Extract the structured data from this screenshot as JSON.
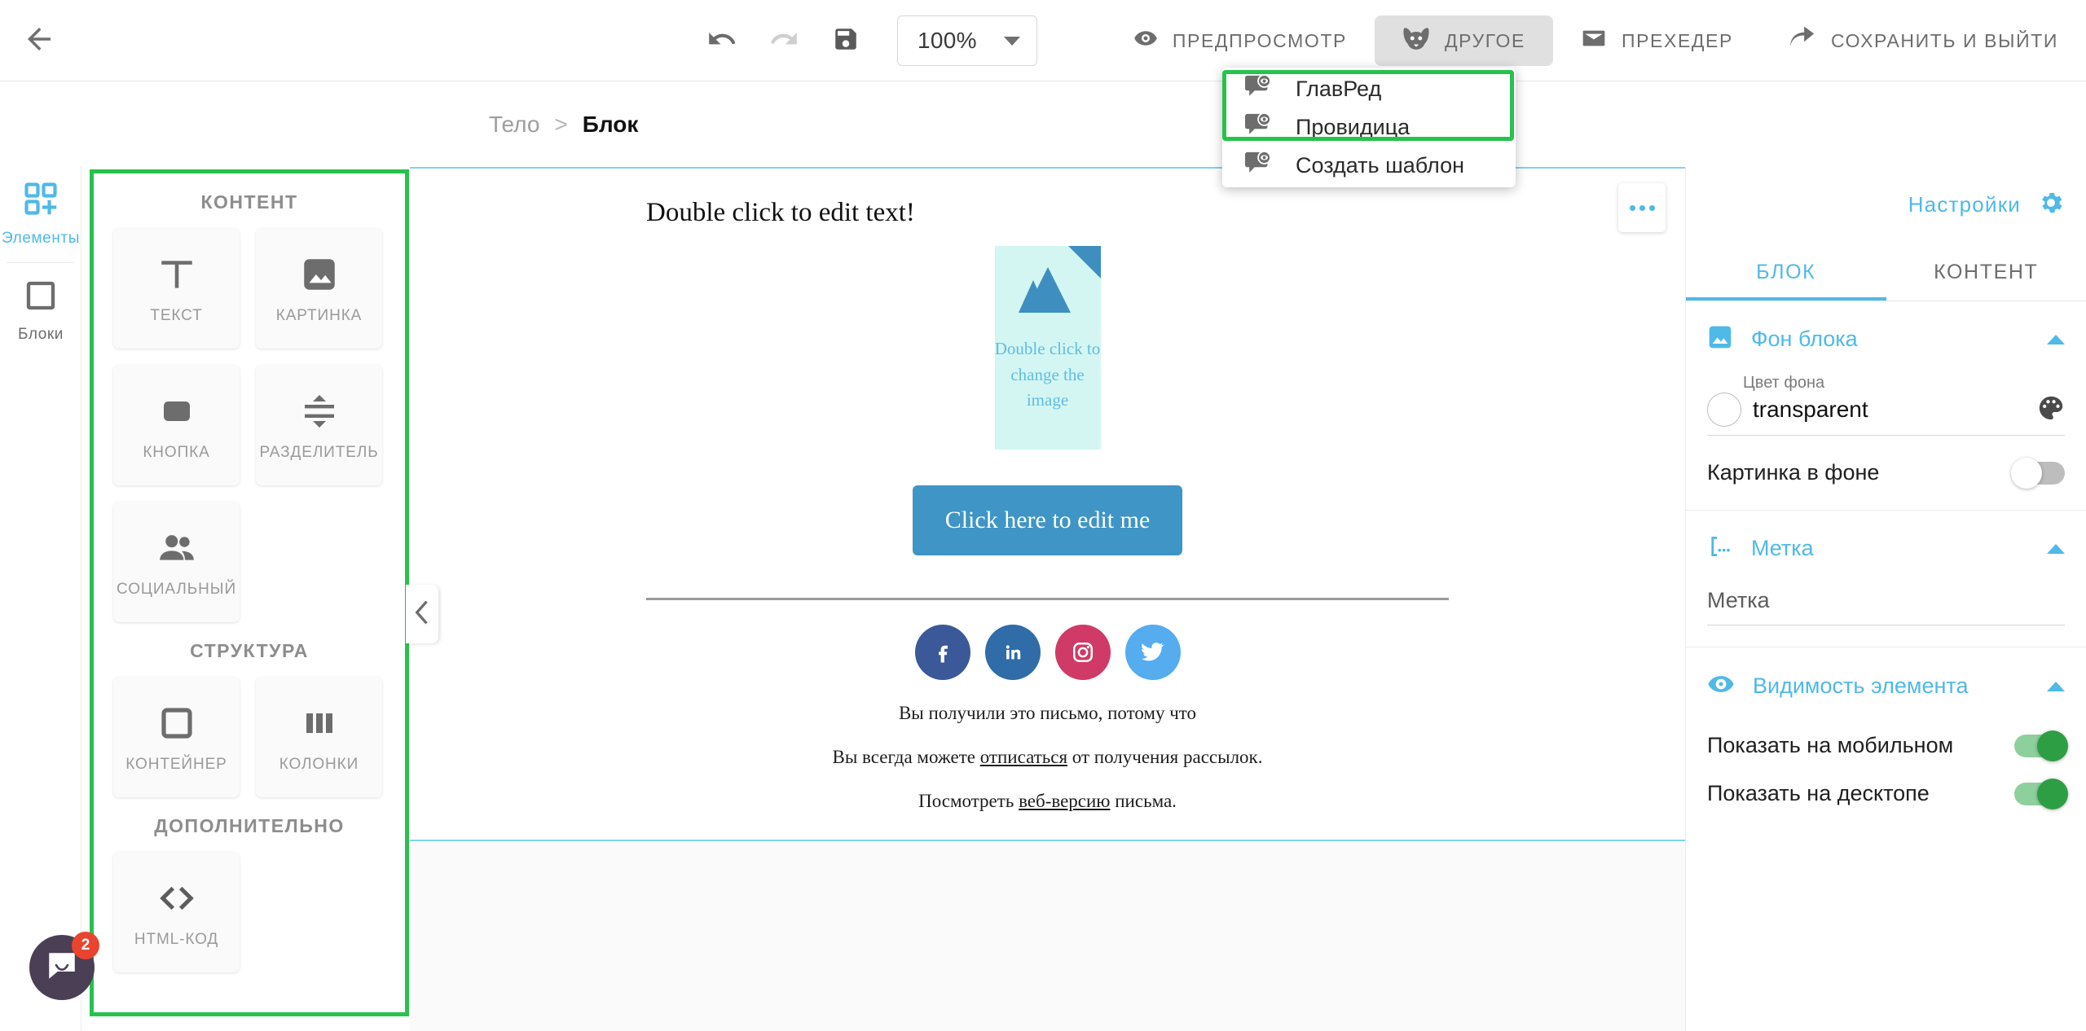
{
  "toolbar": {
    "back_icon": "arrow-left-icon",
    "undo_icon": "undo-icon",
    "redo_icon": "redo-icon",
    "save_icon": "floppy-save-icon",
    "zoom_value": "100%",
    "actions": [
      {
        "id": "preview",
        "label": "ПРЕДПРОСМОТР",
        "icon": "eye-icon",
        "active": false
      },
      {
        "id": "other",
        "label": "ДРУГОЕ",
        "icon": "dog-face-icon",
        "active": true
      },
      {
        "id": "preheader",
        "label": "ПРЕХЕДЕР",
        "icon": "envelope-icon",
        "active": false
      },
      {
        "id": "save-exit",
        "label": "СОХРАНИТЬ И ВЫЙТИ",
        "icon": "share-arrow-icon",
        "active": false
      }
    ]
  },
  "dropdown": {
    "items": [
      {
        "label": "ГлавРед",
        "icon": "speech-eye-icon",
        "highlighted": true
      },
      {
        "label": "Провидица",
        "icon": "speech-eye-icon",
        "highlighted": true
      },
      {
        "label": "Создать шаблон",
        "icon": "speech-eye-icon",
        "highlighted": false
      }
    ]
  },
  "breadcrumb": {
    "icon": "tree-structure-icon",
    "root": "Тело",
    "separator": ">",
    "current": "Блок"
  },
  "rail": {
    "items": [
      {
        "id": "elements",
        "label": "Элементы",
        "icon": "grid-plus-icon",
        "selected": true
      },
      {
        "id": "blocks",
        "label": "Блоки",
        "icon": "square-outline-icon",
        "selected": false
      }
    ]
  },
  "elements_panel": {
    "sections": [
      {
        "title": "КОНТЕНТ",
        "cards": [
          {
            "label": "ТЕКСТ",
            "icon": "text-t-icon"
          },
          {
            "label": "КАРТИНКА",
            "icon": "image-icon"
          },
          {
            "label": "КНОПКА",
            "icon": "button-rect-icon"
          },
          {
            "label": "РАЗДЕЛИТЕЛЬ",
            "icon": "divider-arrows-icon"
          },
          {
            "label": "СОЦИАЛЬНЫЙ",
            "icon": "people-icon"
          }
        ]
      },
      {
        "title": "СТРУКТУРА",
        "cards": [
          {
            "label": "КОНТЕЙНЕР",
            "icon": "container-square-icon"
          },
          {
            "label": "КОЛОНКИ",
            "icon": "columns-icon"
          }
        ]
      },
      {
        "title": "ДОПОЛНИТЕЛЬНО",
        "cards": [
          {
            "label": "HTML-КОД",
            "icon": "code-brackets-icon"
          }
        ]
      }
    ]
  },
  "canvas": {
    "heading": "Double click to edit text!",
    "image_caption_line1": "Double click to",
    "image_caption_line2": "change the image",
    "cta_label": "Click here to edit me",
    "socials": [
      {
        "name": "facebook-icon",
        "color": "#3b5998"
      },
      {
        "name": "linkedin-icon",
        "color": "#2f6ca8"
      },
      {
        "name": "instagram-icon",
        "color": "#cf3a67"
      },
      {
        "name": "twitter-icon",
        "color": "#55acee"
      }
    ],
    "footer_line1": "Вы получили это письмо, потому что",
    "footer_line2_pre": "Вы всегда можете ",
    "footer_line2_link": "отписаться",
    "footer_line2_post": " от получения рассылок.",
    "footer_line3_pre": "Посмотреть ",
    "footer_line3_link": "веб-версию",
    "footer_line3_post": " письма.",
    "options_icon": "more-options-dots-icon",
    "collapse_icon": "chevron-left-icon"
  },
  "right_panel": {
    "settings_label": "Настройки",
    "settings_icon": "gear-icon",
    "tabs": [
      {
        "label": "БЛОК",
        "active": true
      },
      {
        "label": "КОНТЕНТ",
        "active": false
      }
    ],
    "sections": [
      {
        "id": "background",
        "title": "Фон блока",
        "icon": "image-icon",
        "expanded": true,
        "color_label": "Цвет фона",
        "color_value": "transparent",
        "palette_icon": "palette-icon",
        "bg_image_label": "Картинка в фоне",
        "bg_image_on": false
      },
      {
        "id": "label",
        "title": "Метка",
        "icon": "bracket-ellipsis-icon",
        "expanded": true,
        "field_value": "Метка"
      },
      {
        "id": "visibility",
        "title": "Видимость элемента",
        "icon": "eye-icon",
        "expanded": true,
        "rows": [
          {
            "label": "Показать на мобильном",
            "on": true
          },
          {
            "label": "Показать на десктопе",
            "on": true
          }
        ]
      }
    ]
  },
  "chat": {
    "icon": "chat-bubble-icon",
    "badge": "2"
  },
  "colors": {
    "accent_blue": "#4fb9e8",
    "highlight_green": "#27c24c",
    "toggle_green": "#2e9e45",
    "cta_blue": "#3e95c6",
    "canvas_border": "#7fd4e8"
  }
}
